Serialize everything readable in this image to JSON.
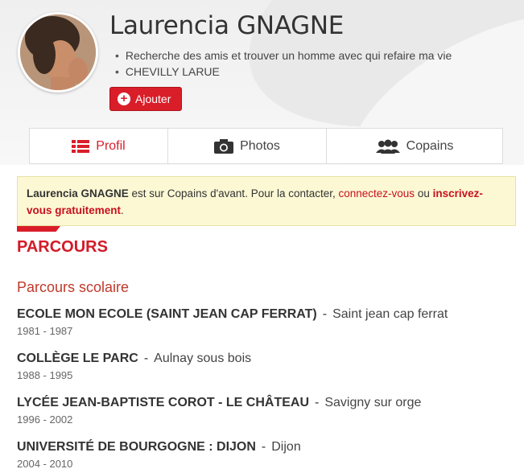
{
  "profile": {
    "name": "Laurencia GNAGNE",
    "bullets": [
      "Recherche des amis et trouver un homme avec qui refaire ma vie",
      "CHEVILLY LARUE"
    ],
    "add_button_label": "Ajouter"
  },
  "tabs": [
    {
      "label": "Profil",
      "icon": "list-icon",
      "active": true
    },
    {
      "label": "Photos",
      "icon": "camera-icon",
      "active": false
    },
    {
      "label": "Copains",
      "icon": "people-icon",
      "active": false
    }
  ],
  "notice": {
    "name": "Laurencia GNAGNE",
    "text1": " est sur Copains d'avant. Pour la contacter, ",
    "link1": "connectez-vous",
    "text2": " ou ",
    "link2": "inscrivez-vous gratuitement",
    "text3": "."
  },
  "parcours": {
    "title": "PARCOURS",
    "subtitle": "Parcours scolaire",
    "entries": [
      {
        "school": "ECOLE MON ECOLE (SAINT JEAN CAP FERRAT)",
        "sep": "-",
        "city": "Saint jean cap ferrat",
        "years": "1981 - 1987"
      },
      {
        "school": "COLLÈGE LE PARC",
        "sep": "-",
        "city": "Aulnay sous bois",
        "years": "1988 - 1995"
      },
      {
        "school": "LYCÉE JEAN-BAPTISTE COROT - LE CHÂTEAU",
        "sep": "-",
        "city": "Savigny sur orge",
        "years": "1996 - 2002"
      },
      {
        "school": "UNIVERSITÉ DE BOURGOGNE : DIJON",
        "sep": "-",
        "city": "Dijon",
        "years": "2004 - 2010"
      }
    ]
  },
  "colors": {
    "accent": "#d91e2a",
    "notice_bg": "#fcf8d4"
  }
}
